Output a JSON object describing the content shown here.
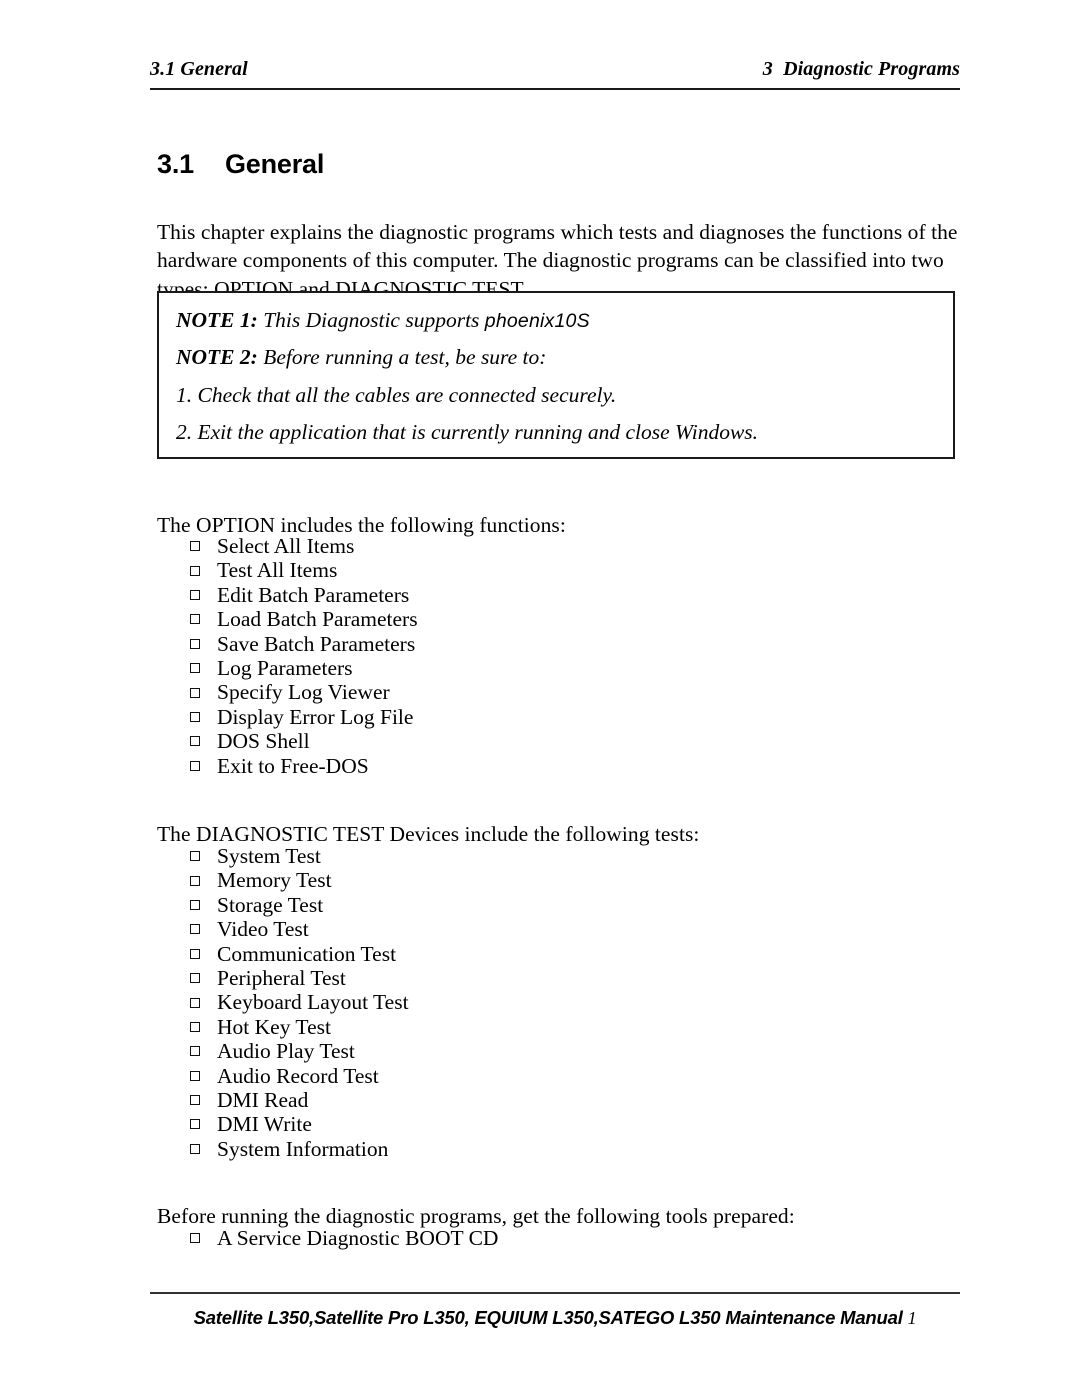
{
  "header": {
    "left": "3.1 General",
    "right": "3  Diagnostic Programs"
  },
  "section": {
    "number": "3.1",
    "title": "General"
  },
  "intro_paragraph": "This chapter explains the diagnostic programs which tests and diagnoses the functions of the hardware components of this computer. The diagnostic programs can be classified into two types: OPTION and DIAGNOSTIC TEST.",
  "note_box": {
    "note1_label": "NOTE 1:",
    "note1_text": " This Diagnostic supports ",
    "note1_brand": "phoenix10S",
    "note2_label": "NOTE 2:",
    "note2_text": "  Before running a test, be sure to:",
    "item1": "1. Check that all the cables are connected securely.",
    "item2": "2. Exit the application that is currently running and close Windows."
  },
  "option_section": {
    "intro": "The OPTION includes the following functions:",
    "items": [
      "Select All Items",
      "Test All Items",
      "Edit Batch Parameters",
      "Load Batch Parameters",
      "Save Batch Parameters",
      "Log Parameters",
      "Specify Log Viewer",
      "Display Error Log File",
      "DOS Shell",
      "Exit to Free-DOS"
    ]
  },
  "diagnostic_section": {
    "intro": "The DIAGNOSTIC TEST Devices include the following tests:",
    "items": [
      "System Test",
      "Memory Test",
      "Storage Test",
      "Video Test",
      "Communication Test",
      "Peripheral Test",
      "Keyboard Layout Test",
      "Hot Key Test",
      "Audio Play Test",
      "Audio Record Test",
      "DMI Read",
      "DMI Write",
      "System Information"
    ]
  },
  "tools_section": {
    "intro": "Before running the diagnostic programs, get the following tools prepared:",
    "items": [
      "A Service Diagnostic BOOT CD"
    ]
  },
  "footer": {
    "text": "Satellite L350,Satellite Pro L350, EQUIUM L350,SATEGO L350 Maintenance Manual ",
    "page_number": "1"
  }
}
